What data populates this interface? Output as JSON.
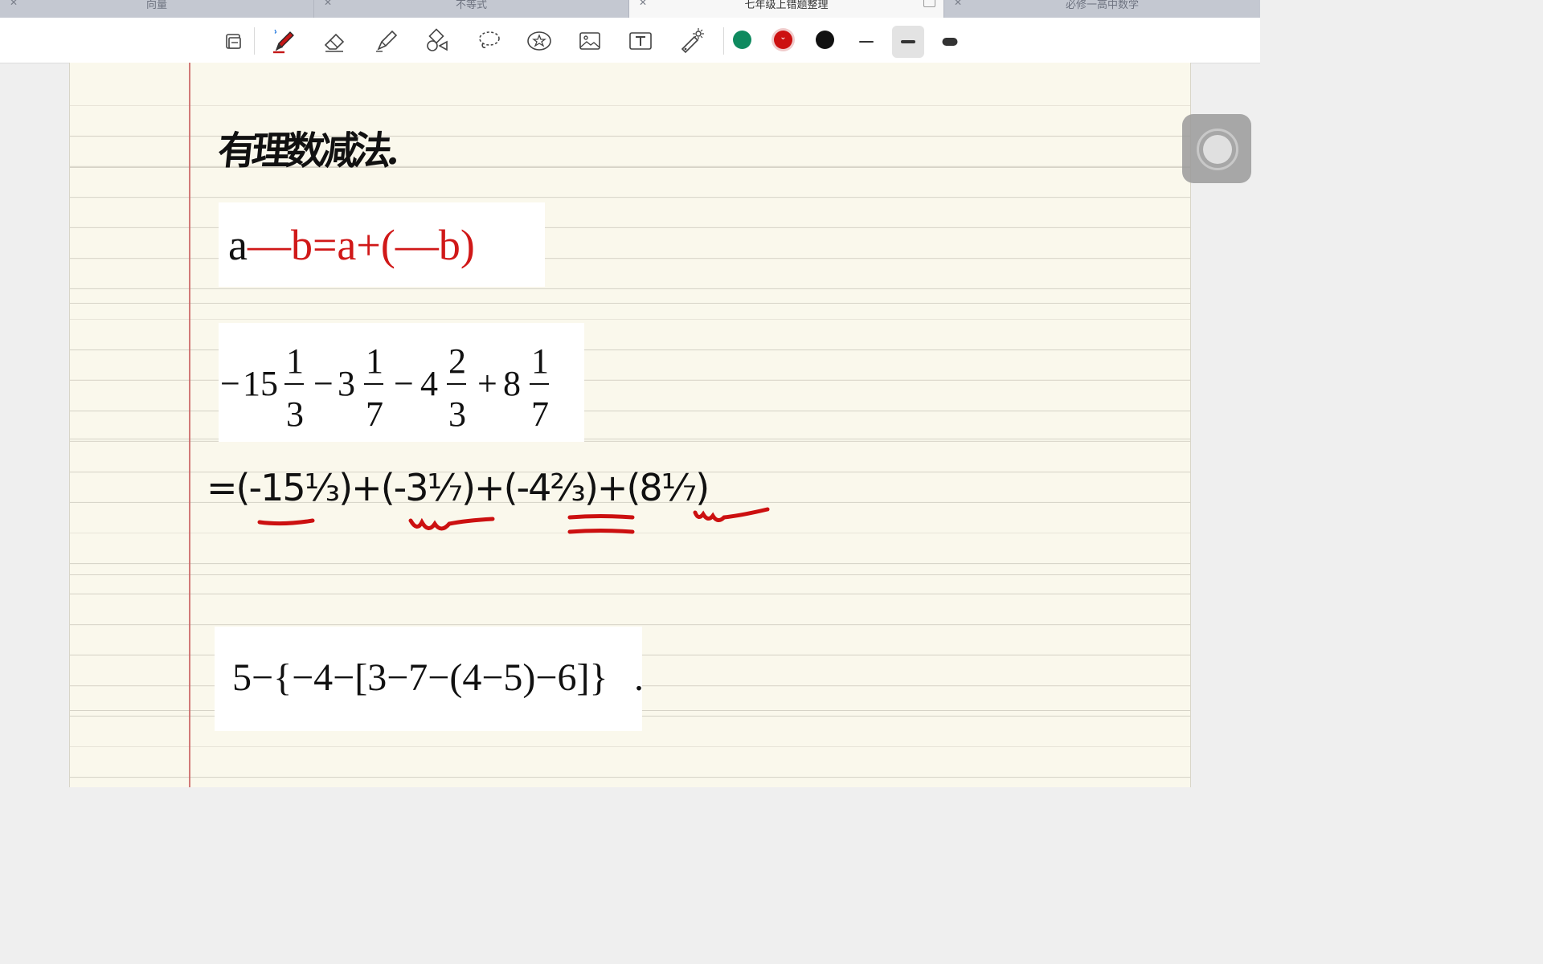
{
  "tabs": [
    {
      "label": "向量",
      "active": false
    },
    {
      "label": "不等式",
      "active": false
    },
    {
      "label": "七年级上错题整理",
      "active": true
    },
    {
      "label": "必修一高中数学",
      "active": false
    }
  ],
  "toolbar": {
    "tools": [
      "page-icon",
      "pen-icon",
      "eraser-icon",
      "highlighter-icon",
      "shapes-icon",
      "lasso-icon",
      "sticker-icon",
      "image-icon",
      "text-icon",
      "laser-pointer-icon"
    ],
    "colors": [
      "#0f8a5f",
      "#cc1010",
      "#111111"
    ],
    "selected_color": "#cc1010",
    "stroke_widths": [
      "thin",
      "medium",
      "thick"
    ],
    "selected_stroke": "medium"
  },
  "note": {
    "heading": "有理数减法.",
    "formula1": {
      "a": "a",
      "rest": "—b=a+(—b)"
    },
    "formula2": {
      "terms": [
        {
          "sign": "−",
          "whole": "15",
          "num": "1",
          "den": "3"
        },
        {
          "sign": "−",
          "whole": "3",
          "num": "1",
          "den": "7"
        },
        {
          "sign": "−",
          "whole": "4",
          "num": "2",
          "den": "3"
        },
        {
          "sign": "+",
          "whole": "8",
          "num": "1",
          "den": "7"
        }
      ]
    },
    "handwritten_step": "=(-15⅓)+(-3⅐)+(-4⅔)+(8⅐)",
    "formula3": {
      "expr": "5−{−4−[3−7−(4−5)−6]}",
      "dot": "."
    }
  },
  "colors": {
    "accent_red": "#cc1010",
    "paper": "#faf8ec",
    "margin": "#c96464"
  }
}
